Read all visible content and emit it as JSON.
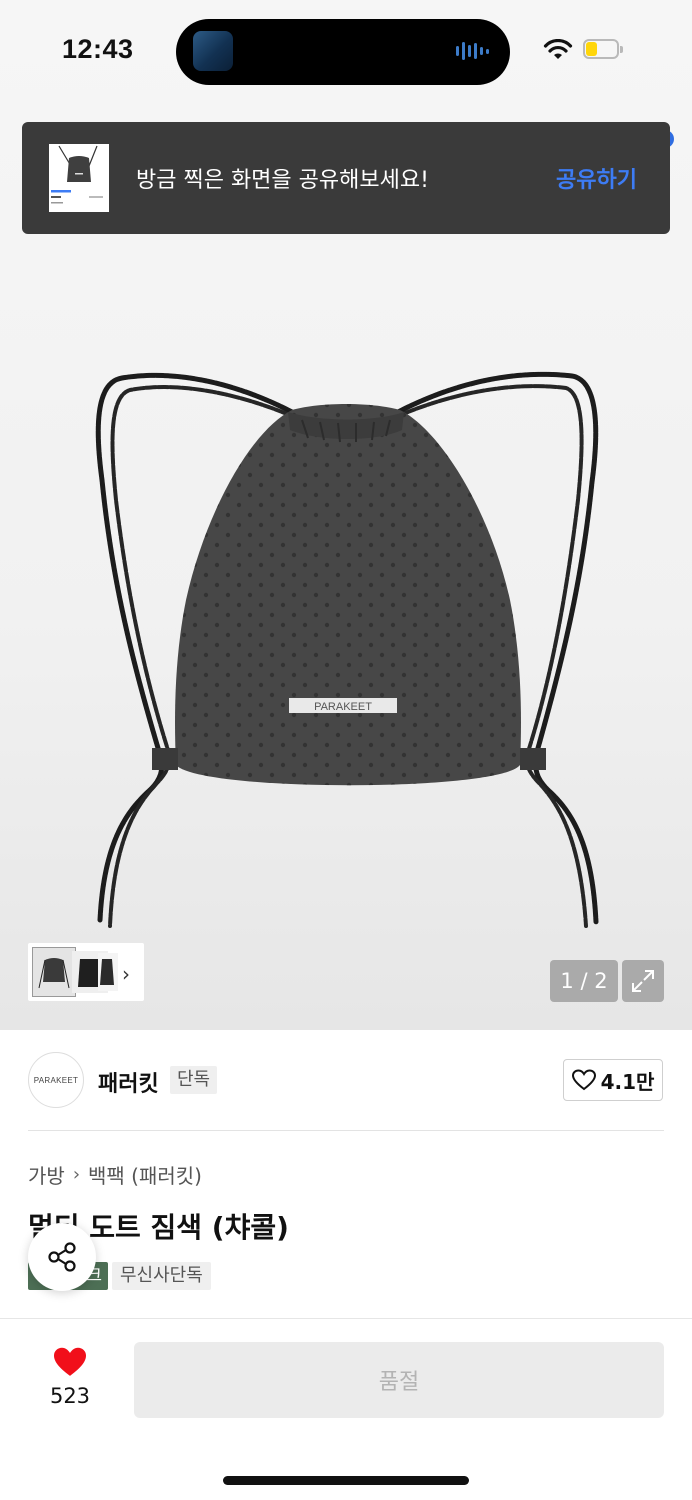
{
  "status_bar": {
    "time": "12:43"
  },
  "toast": {
    "message": "방금 찍은 화면을 공유해보세요!",
    "action": "공유하기"
  },
  "product_image": {
    "label_text": "PARAKEET"
  },
  "gallery": {
    "page_indicator": "1 / 2"
  },
  "brand": {
    "logo_text": "PARAKEET",
    "name": "패러킷",
    "exclusive_tag": "단독",
    "likes": "4.1만"
  },
  "breadcrumb": {
    "category": "가방",
    "subcategory": "백팩 (패러킷)"
  },
  "product": {
    "title": "멀티 도트 짐색 (챠콜)",
    "badge_partial": "크",
    "badge_exclusive": "무신사단독"
  },
  "bottom_bar": {
    "like_count": "523",
    "buy_button_label": "품절"
  },
  "icons": {
    "like": "heart-filled-icon",
    "brand_like": "heart-outline-icon",
    "share": "share-icon",
    "expand": "expand-icon",
    "thumb_next": "chevron-right-icon"
  },
  "colors": {
    "toast_action": "#3d7cf5",
    "like": "#f10f1a",
    "badge_green": "#4d6f55"
  }
}
